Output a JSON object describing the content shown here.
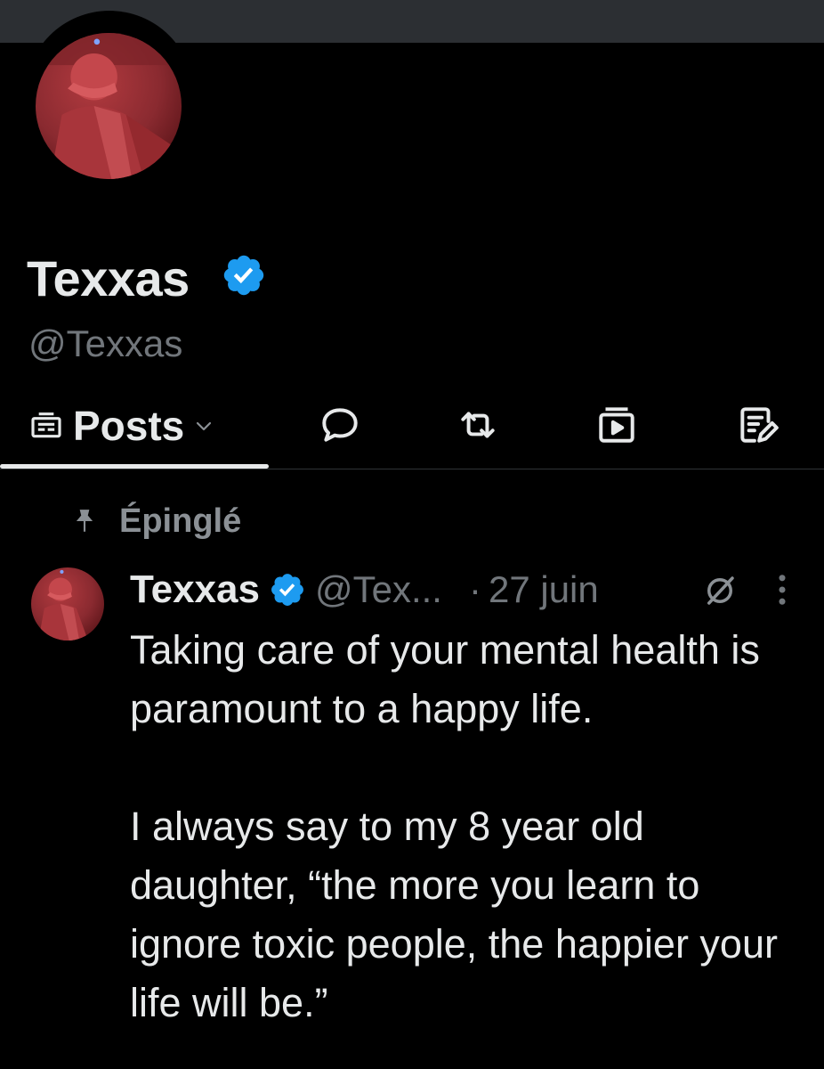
{
  "profile": {
    "display_name": "Texxas",
    "handle": "@Texxas",
    "verified": true,
    "avatar": "avatar-photo-red"
  },
  "tabs": {
    "posts_label": "Posts",
    "items": [
      {
        "name": "posts",
        "icon": "posts-icon"
      },
      {
        "name": "replies",
        "icon": "reply-bubble-icon"
      },
      {
        "name": "reposts",
        "icon": "repost-icon"
      },
      {
        "name": "media",
        "icon": "video-icon"
      },
      {
        "name": "articles",
        "icon": "article-edit-icon"
      }
    ]
  },
  "pinned": {
    "label": "Épinglé",
    "icon": "pin-icon"
  },
  "post": {
    "author_name": "Texxas",
    "author_handle": "@Tex...",
    "separator": "·",
    "date": "27 juin",
    "paragraph_1": "Taking care of your mental health is paramount to a happy life.",
    "paragraph_2": "I always say to my 8 year old daughter, “the more you learn to ignore toxic people, the happier your life will be.”"
  },
  "colors": {
    "background": "#000000",
    "text": "#e7e9ea",
    "muted": "#71767b",
    "verified": "#1d9bf0",
    "banner": "#2c2f33"
  }
}
